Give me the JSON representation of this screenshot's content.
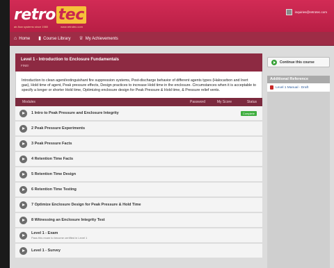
{
  "header": {
    "logo_part1": "retro",
    "logo_part2": "tec",
    "tagline_left": "air-flow systems since 1980",
    "tagline_right": "www.retrotec.com",
    "account_email": "inquiries@retrotec.com"
  },
  "nav": {
    "items": [
      {
        "label": "Home",
        "icon": "home-icon"
      },
      {
        "label": "Course Library",
        "icon": "book-icon"
      },
      {
        "label": "My Achievements",
        "icon": "trophy-icon"
      }
    ]
  },
  "level": {
    "title": "Level 1 - Introduction to Enclosure Fundamentals",
    "subtitle": "FINE!",
    "description": "Introduction to clean agent/extinguishant fire suppression systems, Post-discharge behavior of different agents types (Halocarbon and Inert gas), Hold time of agent, Peak pressure effects, Design practices to increase Hold time in the enclosure. Circumstances when it is acceptable to specify a longer or shorter Hold time, Optimizing enclosure design for Peak Pressure & Hold time, & Pressure relief vents."
  },
  "table": {
    "col_modules": "Modules",
    "col_password": "Password",
    "col_score": "My Score",
    "col_status": "Status"
  },
  "modules": [
    {
      "name": "1 Intro to Peak Pressure and Enclosure Integrity",
      "sub": "",
      "status": "Complete"
    },
    {
      "name": "2 Peak Pressure Experiments",
      "sub": "",
      "status": ""
    },
    {
      "name": "3 Peak Pressure Facts",
      "sub": "",
      "status": ""
    },
    {
      "name": "4 Retention Time Facts",
      "sub": "",
      "status": ""
    },
    {
      "name": "5 Retention Time Design",
      "sub": "",
      "status": ""
    },
    {
      "name": "6 Retention Time Testing",
      "sub": "",
      "status": ""
    },
    {
      "name": "7 Optimize Enclosure Design for Peak Pressure & Hold Time",
      "sub": "",
      "status": ""
    },
    {
      "name": "8 Witnessing an Enclosure Integrity Test",
      "sub": "",
      "status": ""
    },
    {
      "name": "Level 1 - Exam",
      "sub": "Pass this exam to become certified in Level 1",
      "status": ""
    },
    {
      "name": "Level 1 - Survey",
      "sub": "",
      "status": ""
    }
  ],
  "sidebar": {
    "continue_label": "Continue this course",
    "ref_heading": "Additional Reference",
    "ref_items": [
      {
        "label": "Level 1 Manual - Draft"
      }
    ]
  },
  "colors": {
    "header": "#c9264e",
    "nav": "#9e2c46",
    "level_header": "#8d2a42",
    "complete_badge": "#3fae3f",
    "logo_accent": "#f6c13a"
  }
}
